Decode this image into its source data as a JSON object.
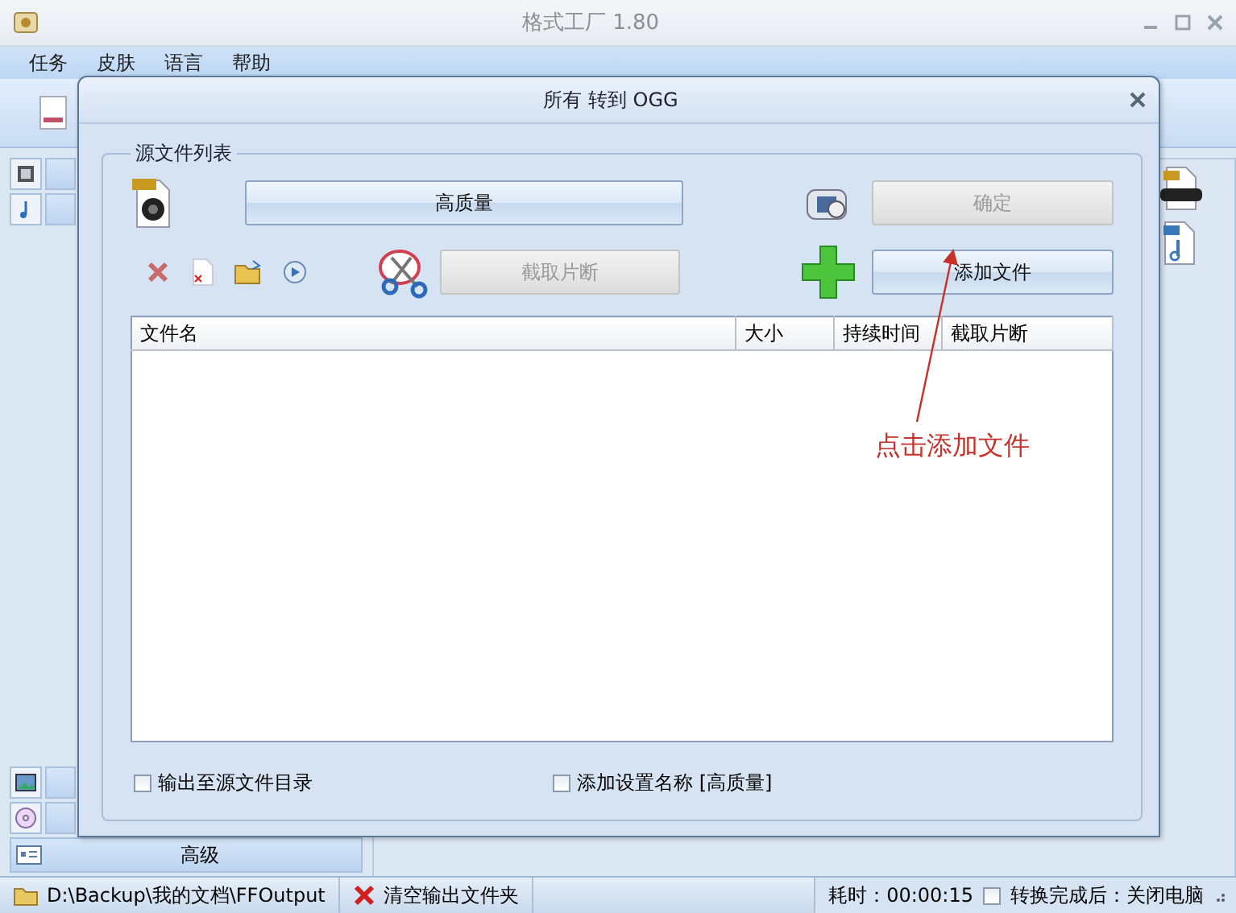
{
  "app": {
    "title": "格式工厂 1.80",
    "menu": [
      "任务",
      "皮肤",
      "语言",
      "帮助"
    ],
    "sidebar": {
      "advanced_label": "高级"
    }
  },
  "dialog": {
    "title": "所有 转到 OGG",
    "group_title": "源文件列表",
    "quality_button": "高质量",
    "ok_button": {
      "label": "确定",
      "disabled": true
    },
    "clip_button": {
      "label": "截取片断",
      "disabled": true
    },
    "add_button": {
      "label": "添加文件",
      "disabled": false
    },
    "table": {
      "columns": [
        "文件名",
        "大小",
        "持续时间",
        "截取片断"
      ]
    },
    "options": [
      {
        "label": "输出至源文件目录",
        "checked": false
      },
      {
        "label": "添加设置名称 [高质量]",
        "checked": false
      }
    ],
    "annotation": "点击添加文件"
  },
  "status_bar": {
    "output_path": "D:\\Backup\\我的文档\\FFOutput",
    "clear_button": "清空输出文件夹",
    "elapsed": "耗时：00:00:15",
    "shutdown": {
      "label": "转换完成后：关闭电脑",
      "checked": false
    }
  }
}
